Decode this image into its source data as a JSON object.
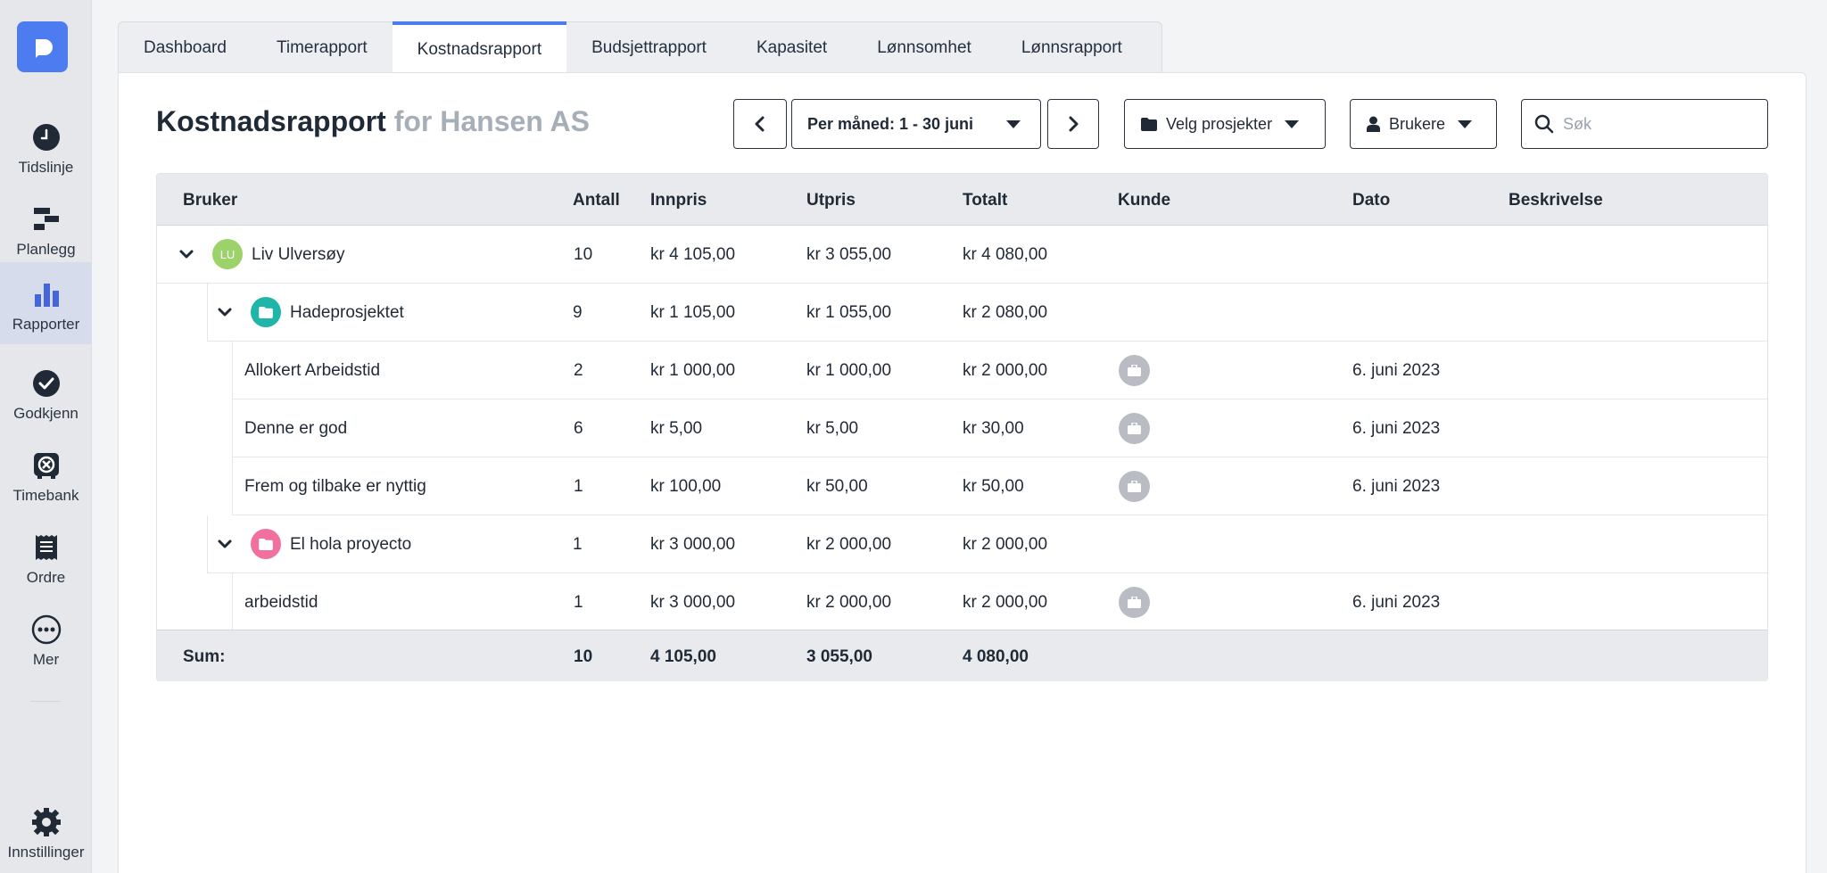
{
  "sidebar": {
    "items": [
      {
        "label": "Tidslinje",
        "icon": "clock-icon"
      },
      {
        "label": "Planlegg",
        "icon": "planner-icon"
      },
      {
        "label": "Rapporter",
        "icon": "bar-chart-icon",
        "active": true
      },
      {
        "label": "Godkjenn",
        "icon": "check-circle-icon"
      },
      {
        "label": "Timebank",
        "icon": "timebank-icon"
      },
      {
        "label": "Ordre",
        "icon": "receipt-icon"
      },
      {
        "label": "Mer",
        "icon": "more-icon"
      }
    ],
    "settings_label": "Innstillinger"
  },
  "tabs": [
    "Dashboard",
    "Timerapport",
    "Kostnadsrapport",
    "Budsjettrapport",
    "Kapasitet",
    "Lønnsomhet",
    "Lønnsrapport"
  ],
  "active_tab": "Kostnadsrapport",
  "header": {
    "title": "Kostnadsrapport",
    "subtitle": "for Hansen AS",
    "period_label": "Per måned: 1 - 30 juni",
    "projects_label": "Velg prosjekter",
    "users_label": "Brukere",
    "search_placeholder": "Søk"
  },
  "table": {
    "columns": [
      "Bruker",
      "Antall",
      "Innpris",
      "Utpris",
      "Totalt",
      "Kunde",
      "Dato",
      "Beskrivelse"
    ],
    "user": {
      "initials": "LU",
      "name": "Liv Ulversøy",
      "antall": "10",
      "innpris": "kr 4 105,00",
      "utpris": "kr 3 055,00",
      "totalt": "kr 4 080,00"
    },
    "project1": {
      "name": "Hadeprosjektet",
      "antall": "9",
      "innpris": "kr 1 105,00",
      "utpris": "kr 1 055,00",
      "totalt": "kr 2 080,00",
      "color": "#1fb5a8"
    },
    "rows1": [
      {
        "name": "Allokert Arbeidstid",
        "antall": "2",
        "innpris": "kr 1 000,00",
        "utpris": "kr 1 000,00",
        "totalt": "kr 2 000,00",
        "dato": "6. juni 2023"
      },
      {
        "name": "Denne er god",
        "antall": "6",
        "innpris": "kr 5,00",
        "utpris": "kr 5,00",
        "totalt": "kr 30,00",
        "dato": "6. juni 2023"
      },
      {
        "name": "Frem og tilbake er nyttig",
        "antall": "1",
        "innpris": "kr 100,00",
        "utpris": "kr 50,00",
        "totalt": "kr 50,00",
        "dato": "6. juni 2023"
      }
    ],
    "project2": {
      "name": "El hola proyecto",
      "antall": "1",
      "innpris": "kr 3 000,00",
      "utpris": "kr 2 000,00",
      "totalt": "kr 2 000,00",
      "color": "#f0719e"
    },
    "rows2": [
      {
        "name": "arbeidstid",
        "antall": "1",
        "innpris": "kr 3 000,00",
        "utpris": "kr 2 000,00",
        "totalt": "kr 2 000,00",
        "dato": "6. juni 2023"
      }
    ],
    "sum": {
      "label": "Sum:",
      "antall": "10",
      "innpris": "4 105,00",
      "utpris": "3 055,00",
      "totalt": "4 080,00"
    }
  }
}
